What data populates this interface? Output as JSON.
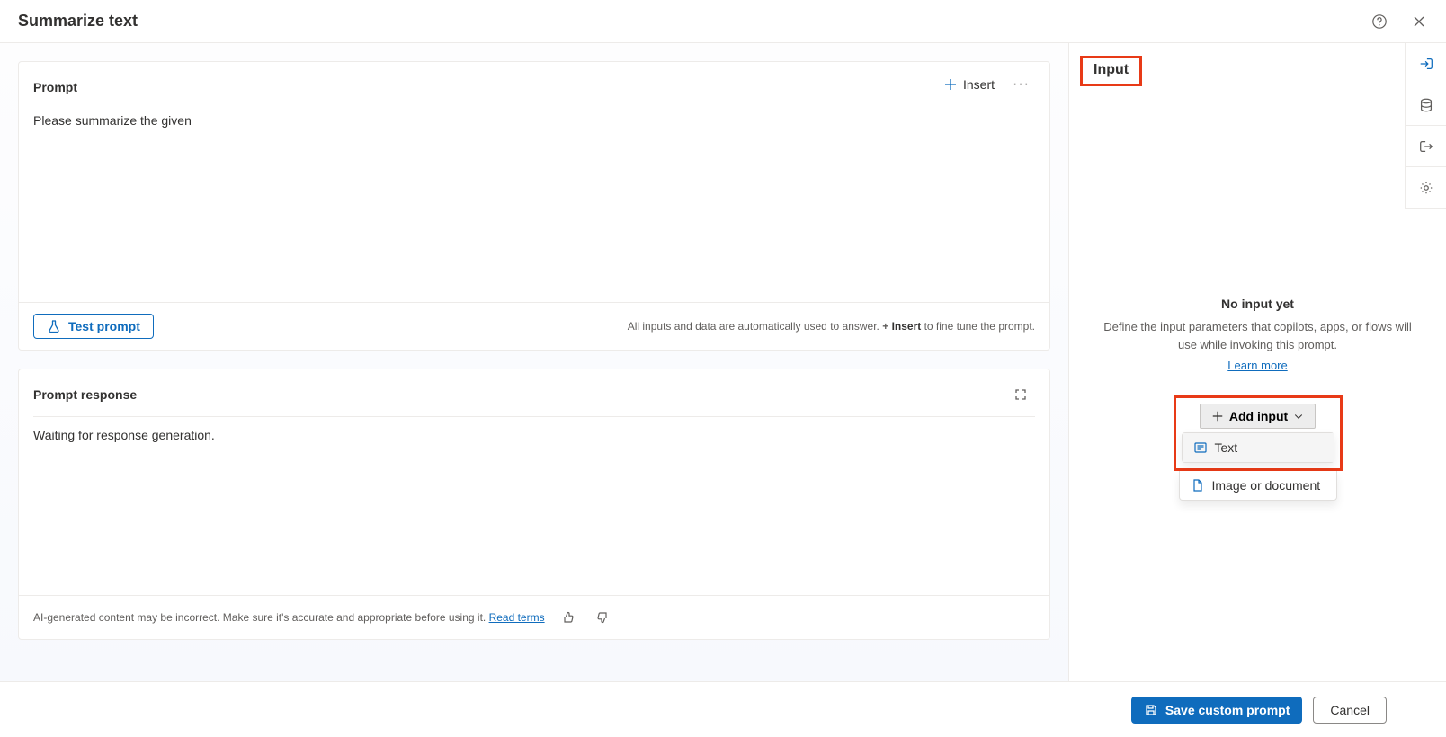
{
  "header": {
    "title": "Summarize text"
  },
  "prompt": {
    "section_title": "Prompt",
    "insert_label": "Insert",
    "text": "Please summarize the given",
    "test_label": "Test prompt",
    "hint_prefix": "All inputs and data are automatically used to answer. ",
    "hint_plus": "+ ",
    "hint_insert": "Insert",
    "hint_suffix": " to fine tune the prompt."
  },
  "response": {
    "section_title": "Prompt response",
    "body": "Waiting for response generation.",
    "disclaimer": "AI-generated content may be incorrect. Make sure it's accurate and appropriate before using it. ",
    "read_terms": "Read terms"
  },
  "input_panel": {
    "tab_label": "Input",
    "empty_title": "No input yet",
    "empty_desc": "Define the input parameters that copilots, apps, or flows will use while invoking this prompt.",
    "learn_more": "Learn more",
    "add_input_label": "Add input",
    "options": {
      "text": "Text",
      "image_or_document": "Image or document"
    }
  },
  "footer": {
    "save_label": "Save custom prompt",
    "cancel_label": "Cancel"
  }
}
